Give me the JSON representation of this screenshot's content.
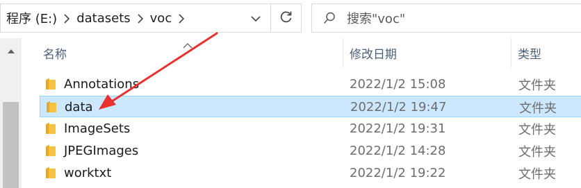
{
  "address_bar": {
    "crumbs": [
      "程序 (E:)",
      "datasets",
      "voc"
    ]
  },
  "search": {
    "placeholder": "搜索\"voc\""
  },
  "columns": {
    "name": "名称",
    "date": "修改日期",
    "type": "类型"
  },
  "rows": [
    {
      "name": "Annotations",
      "date": "2022/1/2 15:08",
      "type": "文件夹",
      "selected": false
    },
    {
      "name": "data",
      "date": "2022/1/2 19:47",
      "type": "文件夹",
      "selected": true
    },
    {
      "name": "ImageSets",
      "date": "2022/1/2 19:31",
      "type": "文件夹",
      "selected": false
    },
    {
      "name": "JPEGImages",
      "date": "2022/1/2 14:28",
      "type": "文件夹",
      "selected": false
    },
    {
      "name": "worktxt",
      "date": "2022/1/2 19:22",
      "type": "文件夹",
      "selected": false
    }
  ],
  "icons": {
    "folder": "folder-icon",
    "refresh": "refresh-icon",
    "search": "search-icon",
    "dropdown": "chevron-down-icon",
    "separator": "chevron-right-icon",
    "scroll_up": "scroll-up-icon"
  },
  "colors": {
    "selection_fill": "#cce8ff",
    "selection_border": "#99d1ff",
    "folder": "#f5c342",
    "annotation_arrow": "#e8312e",
    "header_text": "#4c607a"
  }
}
